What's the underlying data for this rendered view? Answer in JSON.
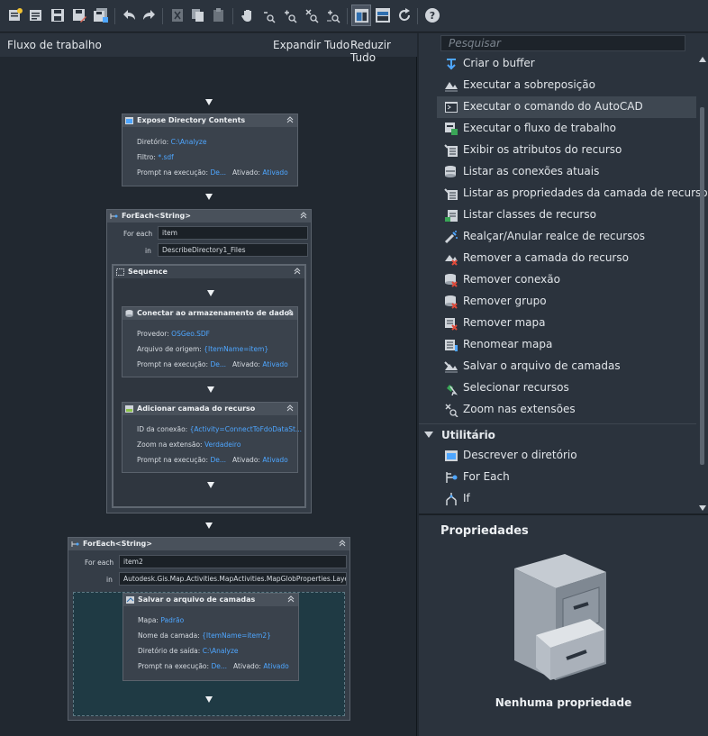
{
  "toolbar": {
    "tools": [
      "new-workflow-icon",
      "open-workflow-icon",
      "save-icon",
      "save-as-icon",
      "save-all-icon",
      "undo-icon",
      "redo-icon",
      "cut-icon",
      "copy-icon",
      "paste-icon",
      "pan-icon",
      "zoom-out-icon",
      "zoom-in-icon",
      "zoom-extents-icon",
      "zoom-window-icon",
      "layout-vertical-icon",
      "layout-horizontal-icon",
      "refresh-icon",
      "help-icon"
    ]
  },
  "workflow": {
    "title": "Fluxo de trabalho",
    "expand_all": "Expandir Tudo",
    "collapse_all": "Reduzir Tudo",
    "expose": {
      "title": "Expose Directory Contents",
      "directory_label": "Diretório:",
      "directory_value": "C:\\Analyze",
      "filter_label": "Filtro:",
      "filter_value": "*.sdf",
      "prompt_label": "Prompt na execução:",
      "prompt_value": "De...",
      "enabled_label": "Ativado:",
      "enabled_value": "Ativado"
    },
    "foreach1": {
      "title": "ForEach<String>",
      "for_each_label": "For each",
      "for_each_value": "item",
      "in_label": "in",
      "in_value": "DescribeDirectory1_Files",
      "sequence_title": "Sequence",
      "connect": {
        "title": "Conectar ao armazenamento de dados",
        "provider_label": "Provedor:",
        "provider_value": "OSGeo.SDF",
        "source_label": "Arquivo de origem:",
        "source_value": "{ItemName=item}",
        "prompt_label": "Prompt na execução:",
        "prompt_value": "De...",
        "enabled_label": "Ativado:",
        "enabled_value": "Ativado"
      },
      "addlayer": {
        "title": "Adicionar camada do recurso",
        "conn_label": "ID da conexão:",
        "conn_value": "{Activity=ConnectToFdoDataSt...",
        "zoom_label": "Zoom na extensão:",
        "zoom_value": "Verdadeiro",
        "prompt_label": "Prompt na execução:",
        "prompt_value": "De...",
        "enabled_label": "Ativado:",
        "enabled_value": "Ativado"
      }
    },
    "foreach2": {
      "title": "ForEach<String>",
      "for_each_label": "For each",
      "for_each_value": "item2",
      "in_label": "in",
      "in_value": "Autodesk.Gis.Map.Activities.MapActivities.MapGlobProperties.Layers",
      "save": {
        "title": "Salvar o arquivo de camadas",
        "map_label": "Mapa:",
        "map_value": "Padrão",
        "layer_label": "Nome da camada:",
        "layer_value": "{ItemName=item2}",
        "dir_label": "Diretório de saída:",
        "dir_value": "C:\\Analyze",
        "prompt_label": "Prompt na execução:",
        "prompt_value": "De...",
        "enabled_label": "Ativado:",
        "enabled_value": "Ativado"
      }
    }
  },
  "toolbox": {
    "search_placeholder": "Pesquisar",
    "items": [
      {
        "label": "Criar o buffer",
        "icon": "buffer-icon"
      },
      {
        "label": "Executar a sobreposição",
        "icon": "overlay-icon"
      },
      {
        "label": "Executar o comando do AutoCAD",
        "icon": "autocad-command-icon"
      },
      {
        "label": "Executar o fluxo de trabalho",
        "icon": "run-workflow-icon"
      },
      {
        "label": "Exibir os atributos do recurso",
        "icon": "feature-attributes-icon"
      },
      {
        "label": "Listar as conexões atuais",
        "icon": "database-connections-icon"
      },
      {
        "label": "Listar as propriedades da camada de recurso",
        "icon": "layer-properties-icon"
      },
      {
        "label": "Listar classes de recurso",
        "icon": "feature-classes-icon"
      },
      {
        "label": "Realçar/Anular realce de recursos",
        "icon": "highlight-icon"
      },
      {
        "label": "Remover a camada do recurso",
        "icon": "remove-layer-icon"
      },
      {
        "label": "Remover conexão",
        "icon": "remove-connection-icon"
      },
      {
        "label": "Remover grupo",
        "icon": "remove-group-icon"
      },
      {
        "label": "Remover mapa",
        "icon": "remove-map-icon"
      },
      {
        "label": "Renomear mapa",
        "icon": "rename-map-icon"
      },
      {
        "label": "Salvar o arquivo de camadas",
        "icon": "save-layer-icon"
      },
      {
        "label": "Selecionar recursos",
        "icon": "select-features-icon"
      },
      {
        "label": "Zoom nas extensões",
        "icon": "zoom-extents-icon"
      }
    ],
    "category": "Utilitário",
    "utility_items": [
      {
        "label": "Descrever o diretório",
        "icon": "describe-directory-icon"
      },
      {
        "label": "For Each",
        "icon": "foreach-icon"
      },
      {
        "label": "If",
        "icon": "if-icon"
      }
    ]
  },
  "properties": {
    "title": "Propriedades",
    "empty": "Nenhuma propriedade"
  },
  "colors": {
    "accent": "#4ea6ff",
    "background": "#212830",
    "panel": "#2b333d"
  }
}
